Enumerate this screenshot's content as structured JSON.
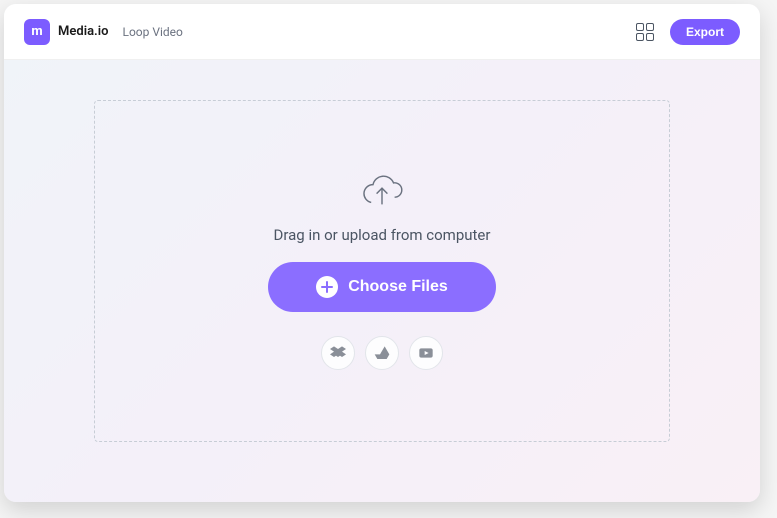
{
  "header": {
    "logo_text": "m",
    "brand": "Media.io",
    "tool": "Loop Video",
    "export_label": "Export"
  },
  "dropzone": {
    "instruction": "Drag in or upload from computer",
    "choose_label": "Choose Files"
  },
  "sources": {
    "dropbox": "dropbox",
    "drive": "google-drive",
    "youtube": "youtube"
  },
  "colors": {
    "accent": "#7c5cff",
    "button": "#8b6eff"
  }
}
